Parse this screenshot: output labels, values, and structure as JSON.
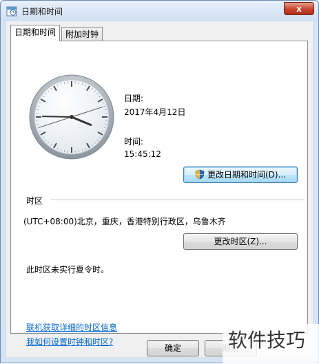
{
  "window": {
    "title": "日期和时间",
    "close_label": "x"
  },
  "tabs": [
    {
      "label": "日期和时间",
      "active": true
    },
    {
      "label": "附加时钟",
      "active": false
    }
  ],
  "datetime": {
    "date_label": "日期:",
    "date_value": "2017年4月12日",
    "time_label": "时间:",
    "time_value": "15:45:12",
    "change_button": "更改日期和时间(D)..."
  },
  "timezone": {
    "heading": "时区",
    "value": "(UTC+08:00)北京，重庆，香港特别行政区，乌鲁木齐",
    "change_button": "更改时区(Z)...",
    "dst_note": "此时区未实行夏令时。"
  },
  "links": {
    "online_info": "联机获取详细的时区信息",
    "how_to": "我如何设置时钟和时区?"
  },
  "footer": {
    "ok_button": "确定",
    "cancel_button": "取消"
  },
  "watermark": "软件技巧",
  "colors": {
    "accent": "#3c7fb1",
    "link": "#0066cc",
    "close": "#c8422c"
  }
}
